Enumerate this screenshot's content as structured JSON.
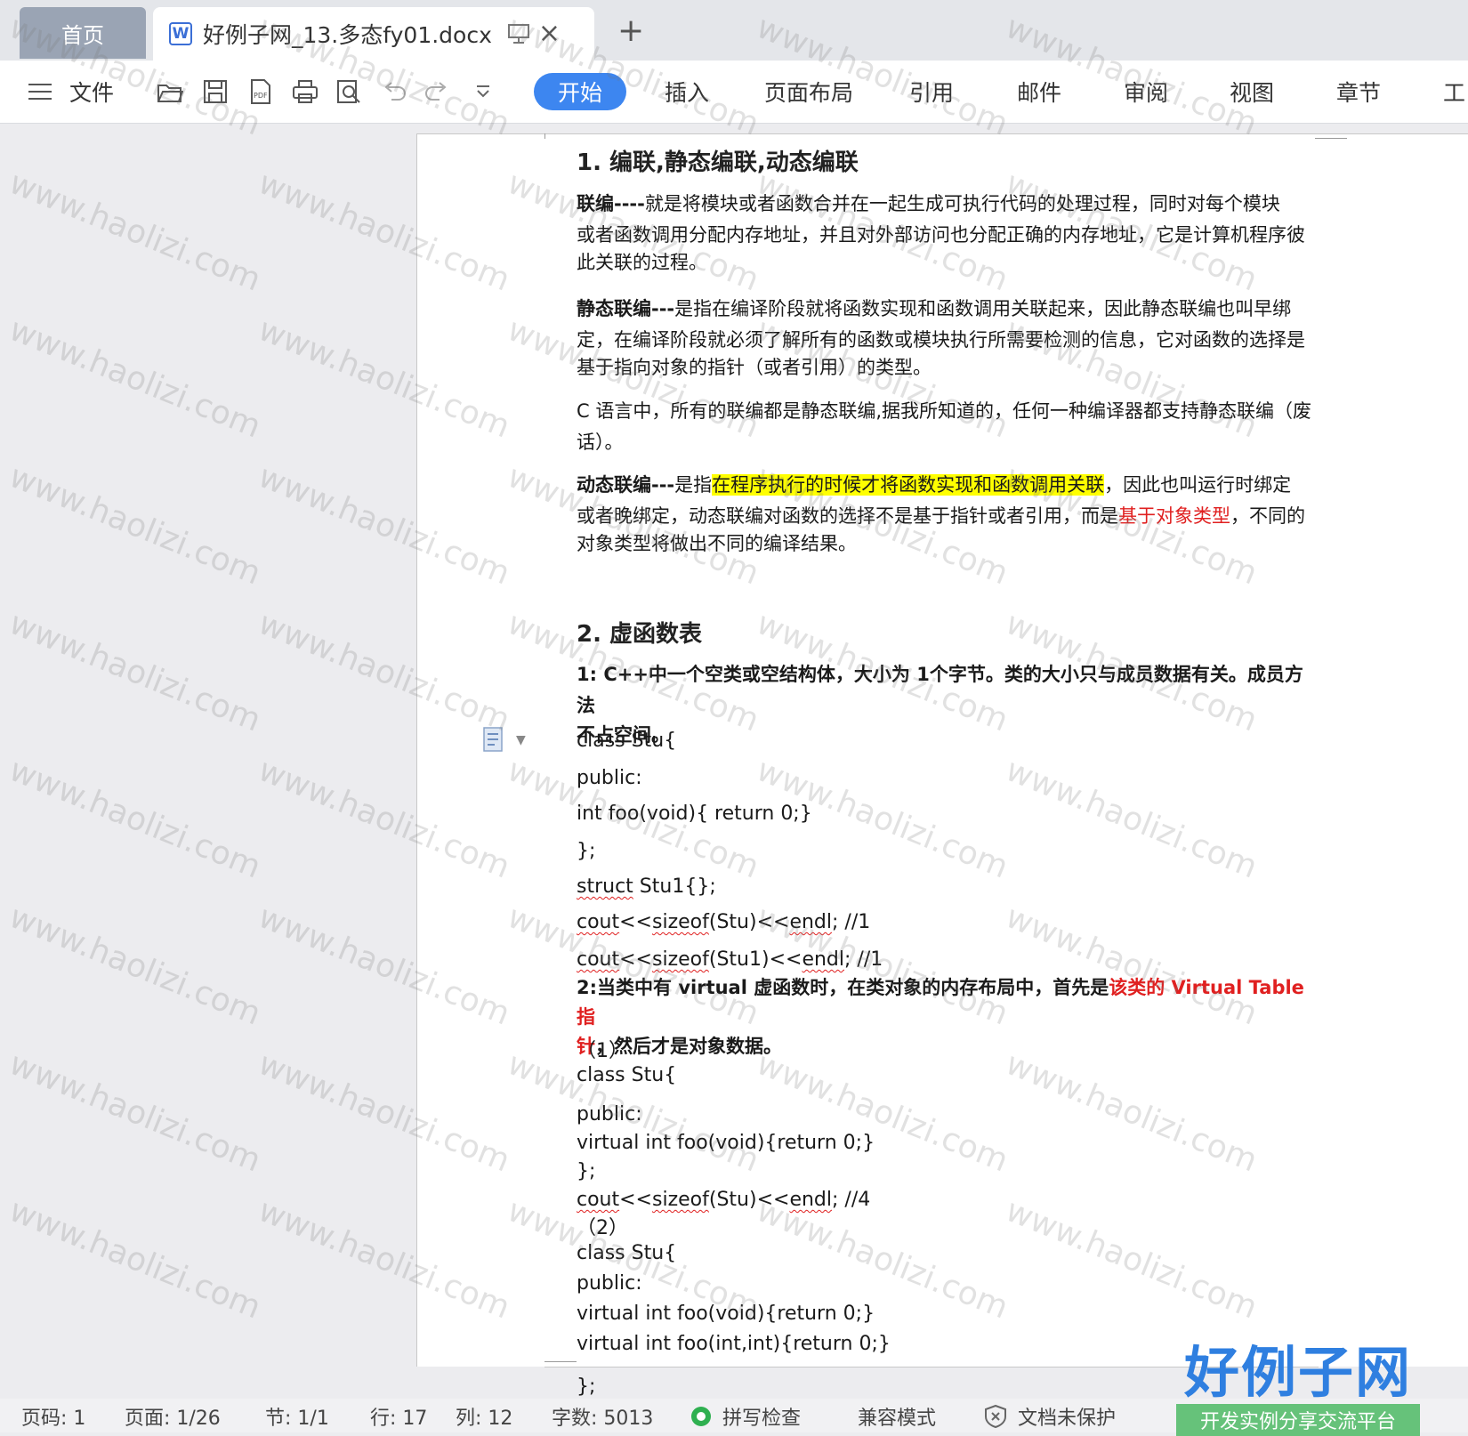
{
  "tabs": {
    "home": "首页",
    "document": "好例子网_13.多态fy01.docx"
  },
  "toolbar": {
    "file": "文件",
    "menus": [
      "开始",
      "插入",
      "页面布局",
      "引用",
      "邮件",
      "审阅",
      "视图",
      "章节",
      "工"
    ]
  },
  "doc": {
    "h1": "1.  编联,静态编联,动态编联",
    "p1_bold": "联编----",
    "p1_line1": "就是将模块或者函数合并在一起生成可执行代码的处理过程，同时对每个模块",
    "p1_line2": "或者函数调用分配内存地址，并且对外部访问也分配正确的内存地址，它是计算机程序彼",
    "p1_line3": "此关联的过程。",
    "p2_bold": "静态联编---",
    "p2_line1": "是指在编译阶段就将函数实现和函数调用关联起来，因此静态联编也叫早绑",
    "p2_line2": "定，在编译阶段就必须了解所有的函数或模块执行所需要检测的信息，它对函数的选择是",
    "p2_line3": "基于指向对象的指针（或者引用）的类型。",
    "p3_line1": "C 语言中，所有的联编都是静态联编,据我所知道的，任何一种编译器都支持静态联编（废",
    "p3_line2": "话）。",
    "p4_bold": "动态联编---",
    "p4_pre": "是指",
    "p4_hl": "在程序执行的时候才将函数实现和函数调用关联",
    "p4_post": "，因此也叫运行时绑定",
    "p4_line2_pre": "或者晚绑定，动态联编对函数的选择不是基于指针或者引用，而是",
    "p4_line2_red": "基于对象类型",
    "p4_line2_post": "，不同的",
    "p4_line3": "对象类型将做出不同的编译结果。",
    "h2": "2.  虚函数表",
    "p5_line1": "1:  C++中一个空类或空结构体，大小为 1个字节。类的大小只与成员数据有关。成员方法",
    "p5_line2": "不占空间。",
    "code1": [
      "class Stu{",
      "public:",
      "int foo(void){   return 0;}",
      "};"
    ],
    "code_struct": "struct",
    "code_struct_rest": " Stu1{};",
    "cout1_a": "cout",
    "cout1_b": "<<",
    "cout1_c": "sizeof",
    "cout1_d": "(Stu)<<",
    "cout1_e": "endl",
    "cout1_f": "; //1",
    "cout2_d": "(Stu1)<<",
    "cout2_f": "; //1",
    "p6_pre": "2:当类中有  virtual  虚函数时，在类对象的内存布局中，首先是",
    "p6_red": "该类的  Virtual Table  指",
    "p6_line2_red": "针",
    "p6_line2_post": "，然后才是对象数据。",
    "sub1": "（1）",
    "code2": [
      "class Stu{",
      "public:",
      "virtual int foo(void){return 0;}",
      "};"
    ],
    "cout3_d": "(Stu)<<",
    "cout3_f": "; //4",
    "sub2": "（2）",
    "code3": [
      "class Stu{",
      "public:",
      "virtual int foo(void){return 0;}",
      "virtual int foo(int,int){return 0;}"
    ],
    "code3_end": "};"
  },
  "status": {
    "page_no": "页码: 1",
    "pages": "页面: 1/26",
    "section": "节: 1/1",
    "line": "行: 17",
    "col": "列: 12",
    "words": "字数: 5013",
    "spell": "拼写检查",
    "compat": "兼容模式",
    "protect": "文档未保护"
  },
  "watermark": "www.haolizi.com",
  "logo": {
    "main": "好例子网",
    "sub": "开发实例分享交流平台"
  },
  "colors": {
    "accent": "#3d86f0",
    "highlight": "#ffff00",
    "red_text": "#e02020"
  }
}
